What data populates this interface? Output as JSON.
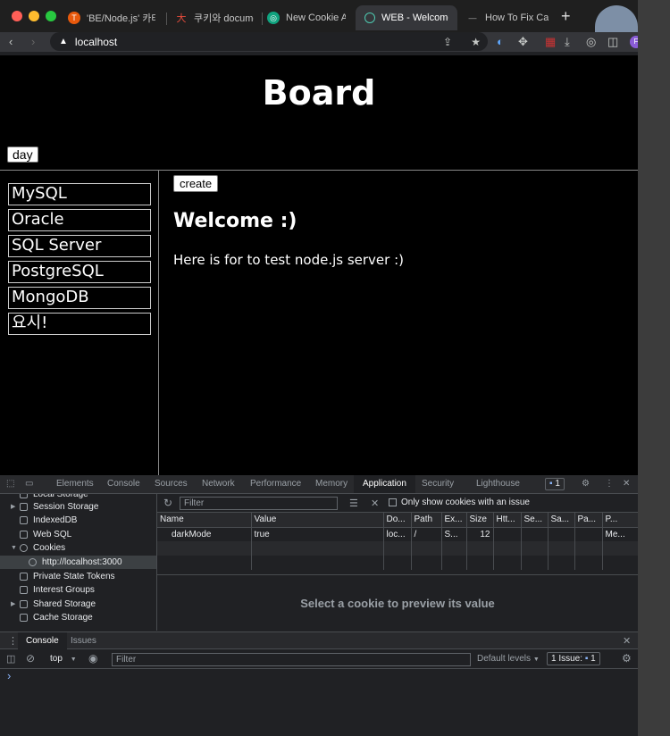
{
  "browser": {
    "tabs": [
      {
        "title": "'BE/Node.js' 카테고",
        "icon_color": "#e8590c",
        "icon_glyph": "T"
      },
      {
        "title": "쿠키와 document.c",
        "icon_color": "#c0392b",
        "icon_glyph": "大"
      },
      {
        "title": "New Cookie Assig",
        "icon_color": "#10a37f",
        "icon_glyph": "◎"
      },
      {
        "title": "WEB - Welcome :",
        "icon_color": "#4ec9b0",
        "icon_glyph": "○"
      },
      {
        "title": "How To Fix Canno",
        "icon_color": "#555555",
        "icon_glyph": "—"
      }
    ],
    "new_tab": "+",
    "url": "localhost",
    "profile_initial": "F"
  },
  "page": {
    "title": "Board",
    "day_button": "day",
    "nav_items": [
      "MySQL",
      "Oracle",
      "SQL Server",
      "PostgreSQL",
      "MongoDB",
      "요시!"
    ],
    "create_button": "create",
    "heading": "Welcome :)",
    "description": "Here is for to test node.js server :)"
  },
  "devtools": {
    "tabs": [
      "Elements",
      "Console",
      "Sources",
      "Network",
      "Performance",
      "Memory",
      "Application",
      "Security",
      "Lighthouse"
    ],
    "active_tab": "Application",
    "issues_badge": "1",
    "sidebar": [
      {
        "label": "Local Storage",
        "caret": "",
        "icon": "db"
      },
      {
        "label": "Session Storage",
        "caret": "▶",
        "icon": "grid"
      },
      {
        "label": "IndexedDB",
        "caret": "",
        "icon": "db"
      },
      {
        "label": "Web SQL",
        "caret": "",
        "icon": "db"
      },
      {
        "label": "Cookies",
        "caret": "▼",
        "icon": "cookie"
      },
      {
        "label": "http://localhost:3000",
        "caret": "",
        "icon": "cookie",
        "selected": true
      },
      {
        "label": "Private State Tokens",
        "caret": "",
        "icon": "db"
      },
      {
        "label": "Interest Groups",
        "caret": "",
        "icon": "db"
      },
      {
        "label": "Shared Storage",
        "caret": "▶",
        "icon": "db"
      },
      {
        "label": "Cache Storage",
        "caret": "",
        "icon": "db"
      }
    ],
    "filter_placeholder": "Filter",
    "only_issue_label": "Only show cookies with an issue",
    "cookie_columns": [
      "Name",
      "Value",
      "Do...",
      "Path",
      "Ex...",
      "Size",
      "Htt...",
      "Se...",
      "Sa...",
      "Pa...",
      "P..."
    ],
    "cookie_rows": [
      [
        "darkMode",
        "true",
        "loc...",
        "/",
        "S...",
        "12",
        "",
        "",
        "",
        "",
        "Me..."
      ]
    ],
    "preview_text": "Select a cookie to preview its value"
  },
  "drawer": {
    "tabs": [
      "Console",
      "Issues"
    ],
    "active_tab": "Console",
    "context": "top",
    "filter_placeholder": "Filter",
    "levels": "Default levels",
    "issue_label": "1 Issue:",
    "issue_count": "1",
    "prompt": "›"
  }
}
